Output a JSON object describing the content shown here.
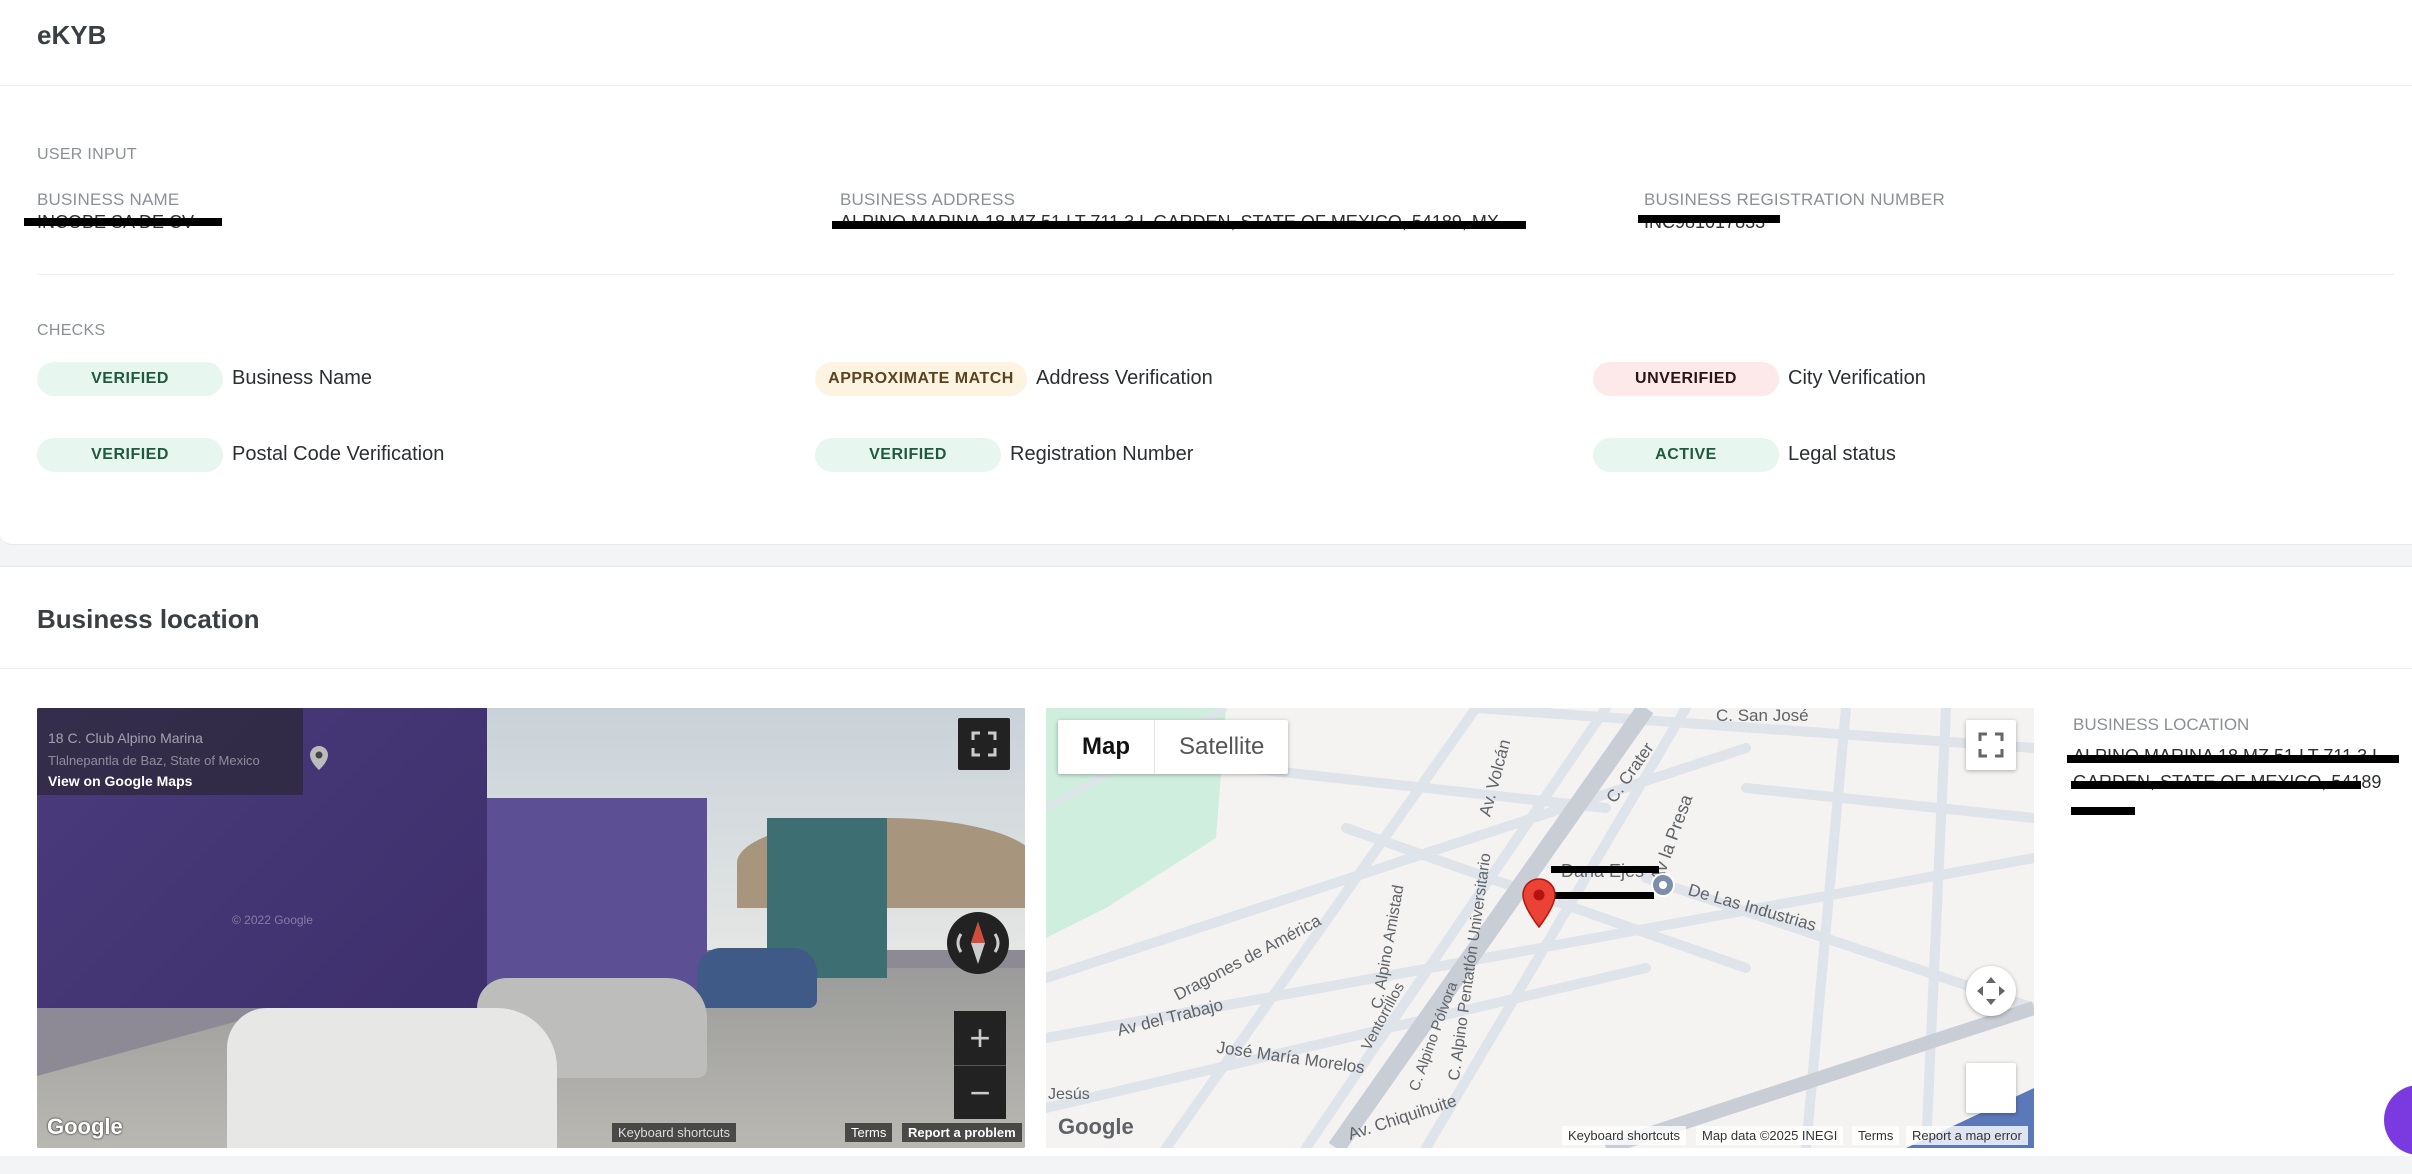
{
  "app": {
    "title": "eKYB"
  },
  "user_input": {
    "section_label": "USER INPUT",
    "fields": [
      {
        "label": "BUSINESS NAME",
        "value": "INCOBE SA DE CV"
      },
      {
        "label": "BUSINESS ADDRESS",
        "value": "ALPINO MARINA 18 MZ 51 LT 711 3 L GARDEN, STATE OF MEXICO, 54189, MX"
      },
      {
        "label": "BUSINESS REGISTRATION NUMBER",
        "value": "INC981017833"
      }
    ]
  },
  "checks": {
    "section_label": "CHECKS",
    "items": [
      {
        "status": "VERIFIED",
        "label": "Business Name",
        "tone": "green"
      },
      {
        "status": "APPROXIMATE MATCH",
        "label": "Address Verification",
        "tone": "amber"
      },
      {
        "status": "UNVERIFIED",
        "label": "City Verification",
        "tone": "red"
      },
      {
        "status": "VERIFIED",
        "label": "Postal Code Verification",
        "tone": "green"
      },
      {
        "status": "VERIFIED",
        "label": "Registration Number",
        "tone": "green"
      },
      {
        "status": "ACTIVE",
        "label": "Legal status",
        "tone": "green"
      }
    ]
  },
  "business_location": {
    "title": "Business location",
    "street_view": {
      "address": "18 C. Club Alpino Marina",
      "city": "Tlalnepantla de Baz, State of Mexico",
      "link": "View on Google Maps",
      "watermark": "© 2022 Google",
      "logo": "Google",
      "attribution": [
        "Keyboard shortcuts",
        "Terms",
        "Report a problem"
      ],
      "icons": [
        "pin-icon",
        "fullscreen-icon",
        "compass-icon",
        "zoom-in-icon",
        "zoom-out-icon"
      ]
    },
    "map": {
      "map_types": [
        "Map",
        "Satellite"
      ],
      "active_type": "Map",
      "streets": [
        "C. San José",
        "Av. Volcán",
        "C. Crater",
        "Av la Presa",
        "Dragones de América",
        "C. Alpino Amistad",
        "C. Alpino Pentatlón Universitario",
        "Ventorrillos",
        "C. Alpino Pólvora",
        "Av del Trabajo",
        "José María Morelos",
        "De Las Industrias",
        "Av. Chiquihuite",
        "Jesús",
        "Dana Ejes"
      ],
      "logo": "Google",
      "attribution": [
        "Keyboard shortcuts",
        "Map data ©2025 INEGI",
        "Terms",
        "Report a map error"
      ],
      "marker_color": "#ea4335",
      "park_color": "#cfeedd"
    },
    "location_label": "BUSINESS LOCATION",
    "location_value": "ALPINO MARINA 18 MZ 51 LT 711 3 L GARDEN, STATE OF MEXICO, 54189"
  },
  "colors": {
    "verified_bg": "#e7f6ef",
    "approximate_bg": "#fdf3e1",
    "unverified_bg": "#fde9ea",
    "fab": "#7b3ae0"
  }
}
